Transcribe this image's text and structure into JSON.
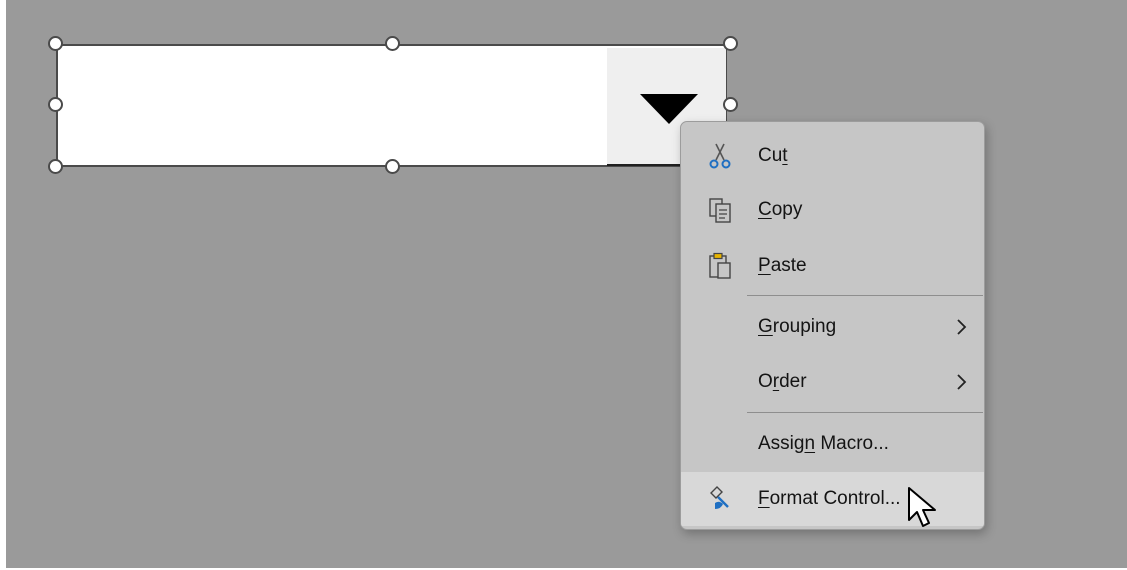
{
  "combo_box": {
    "value": "",
    "dropdown_icon": "dropdown-triangle-icon"
  },
  "context_menu": {
    "items": [
      {
        "label_pre": "Cu",
        "label_u": "t",
        "label_post": "",
        "icon": "scissors-icon"
      },
      {
        "label_pre": "",
        "label_u": "C",
        "label_post": "opy",
        "icon": "copy-icon"
      },
      {
        "label_pre": "",
        "label_u": "P",
        "label_post": "aste",
        "icon": "paste-icon"
      },
      {
        "label_pre": "",
        "label_u": "G",
        "label_post": "rouping",
        "icon": "",
        "submenu": true
      },
      {
        "label_pre": "O",
        "label_u": "r",
        "label_post": "der",
        "icon": "",
        "submenu": true
      },
      {
        "label_pre": "Assig",
        "label_u": "n",
        "label_post": " Macro...",
        "icon": ""
      },
      {
        "label_pre": "",
        "label_u": "F",
        "label_post": "ormat Control...",
        "icon": "format-brush-icon",
        "highlighted": true
      }
    ]
  },
  "colors": {
    "background": "#9a9a9a",
    "menu_background": "#c6c6c6",
    "menu_highlight": "#d8d8d8",
    "paste_accent": "#e8b400",
    "scissors_accent": "#1f6fc2"
  }
}
